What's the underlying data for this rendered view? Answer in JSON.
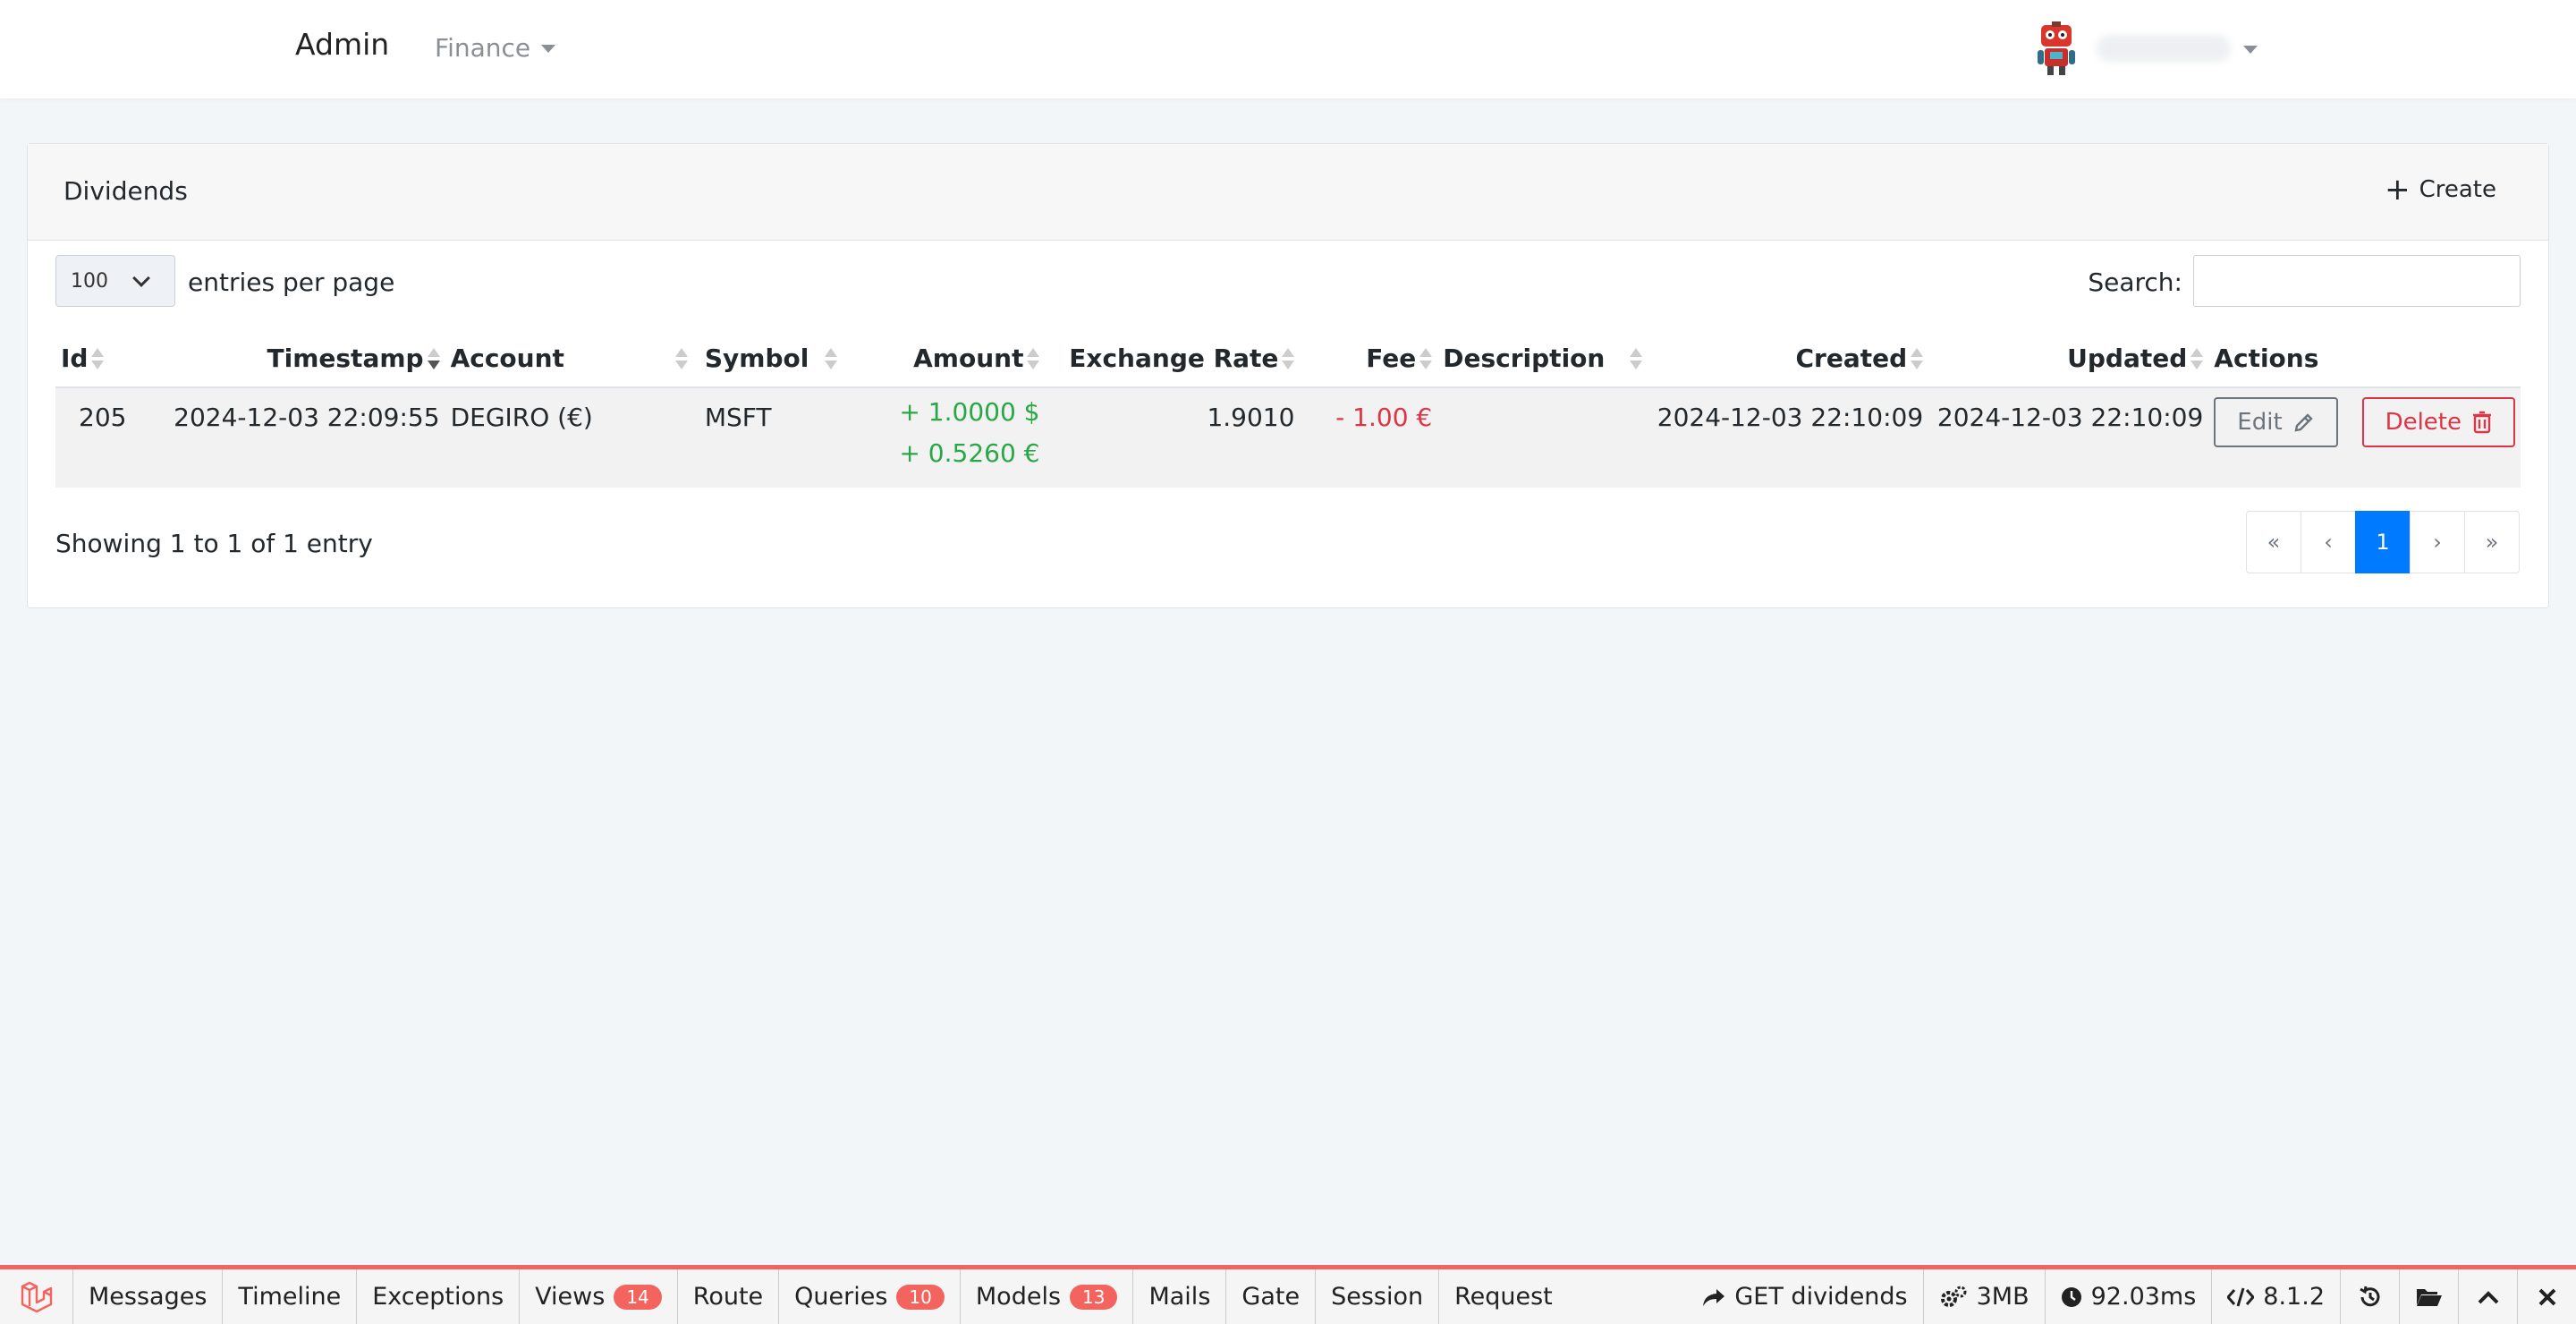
{
  "navbar": {
    "brand": "Admin",
    "menu_label": "Finance"
  },
  "card": {
    "title": "Dividends",
    "create_label": "Create"
  },
  "controls": {
    "per_page_value": "100",
    "per_page_label": "entries per page",
    "search_label": "Search:",
    "search_value": ""
  },
  "table": {
    "columns": [
      "Id",
      "Timestamp",
      "Account",
      "Symbol",
      "Amount",
      "Exchange Rate",
      "Fee",
      "Description",
      "Created",
      "Updated",
      "Actions"
    ],
    "rows": [
      {
        "id": "205",
        "timestamp": "2024-12-03 22:09:55",
        "account": "DEGIRO (€)",
        "symbol": "MSFT",
        "amount_primary": "+ 1.0000 $",
        "amount_secondary": "+ 0.5260 €",
        "exchange_rate": "1.9010",
        "fee": "- 1.00 €",
        "description": "",
        "created": "2024-12-03 22:10:09",
        "updated": "2024-12-03 22:10:09",
        "edit_label": "Edit",
        "delete_label": "Delete"
      }
    ]
  },
  "footer": {
    "info": "Showing 1 to 1 of 1 entry",
    "pagination": [
      "«",
      "‹",
      "1",
      "›",
      "»"
    ],
    "active_page": "1"
  },
  "debugbar": {
    "tabs": [
      {
        "label": "Messages"
      },
      {
        "label": "Timeline"
      },
      {
        "label": "Exceptions"
      },
      {
        "label": "Views",
        "badge": "14"
      },
      {
        "label": "Route"
      },
      {
        "label": "Queries",
        "badge": "10"
      },
      {
        "label": "Models",
        "badge": "13"
      },
      {
        "label": "Mails"
      },
      {
        "label": "Gate"
      },
      {
        "label": "Session"
      },
      {
        "label": "Request"
      }
    ],
    "request": "GET dividends",
    "memory": "3MB",
    "time": "92.03ms",
    "php_version": "8.1.2"
  },
  "colors": {
    "primary": "#007bff",
    "success": "#28a745",
    "danger": "#dc3545",
    "debugbar_accent": "#f4645f"
  }
}
